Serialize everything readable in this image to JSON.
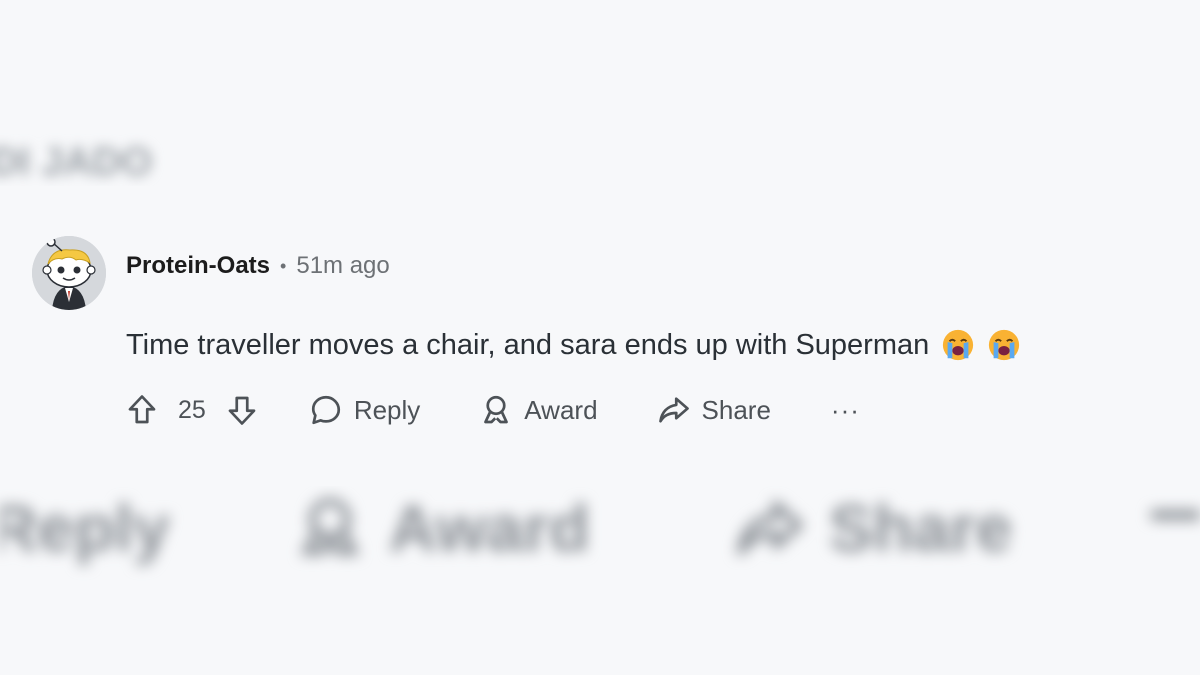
{
  "background_blur": {
    "top_text": "DI JADO",
    "bottom": {
      "reply_label": "Reply",
      "award_label": "Award",
      "share_label": "Share"
    }
  },
  "comment": {
    "username": "Protein-Oats",
    "separator": "•",
    "timestamp": "51m ago",
    "text": "Time traveller moves a chair, and sara ends up with Superman",
    "emojis": [
      "loudly-crying-face",
      "loudly-crying-face"
    ],
    "score": "25",
    "actions": {
      "reply": "Reply",
      "award": "Award",
      "share": "Share",
      "more": "···"
    }
  },
  "colors": {
    "background": "#f7f8fa",
    "text_muted": "#6d7175",
    "icon": "#4d5257",
    "username": "#1c1c1c"
  }
}
